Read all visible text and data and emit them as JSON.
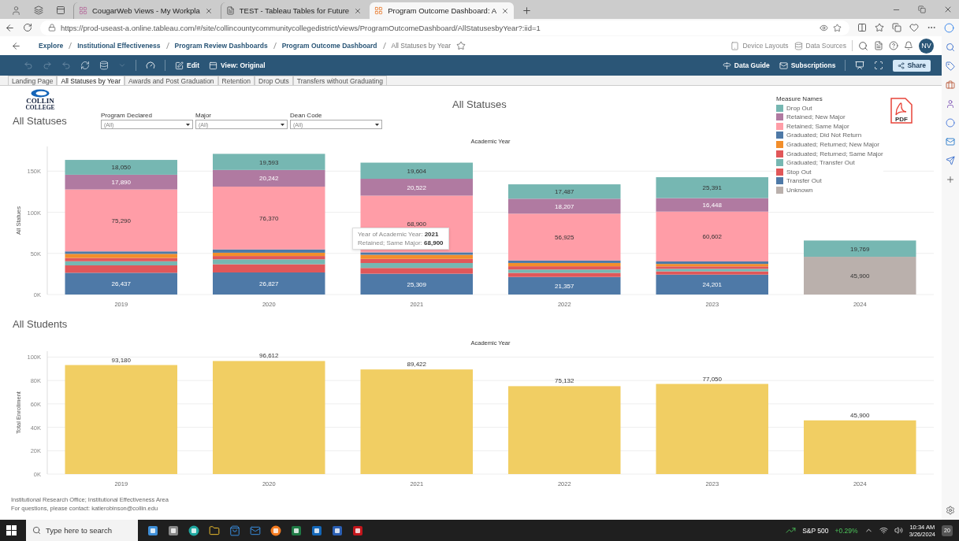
{
  "browser": {
    "tabs": [
      {
        "title": "CougarWeb Views - My Workpla",
        "selected": false
      },
      {
        "title": "TEST - Tableau Tables for Future",
        "selected": false
      },
      {
        "title": "Program Outcome Dashboard: A",
        "selected": true
      }
    ],
    "address": "https://prod-useast-a.online.tableau.com/#/site/collincountycommunitycollegedistrict/views/ProgramOutcomeDashboard/AllStatusesbyYear?:iid=1"
  },
  "breadcrumb": [
    {
      "label": "Explore",
      "current": false
    },
    {
      "label": "Institutional Effectiveness",
      "current": false
    },
    {
      "label": "Program Review Dashboards",
      "current": false
    },
    {
      "label": "Program Outcome Dashboard",
      "current": false
    },
    {
      "label": "All Statuses by Year",
      "current": true
    }
  ],
  "header_actions": [
    "Device Layouts",
    "Data Sources"
  ],
  "avatar": "NV",
  "toolbar": {
    "left": [
      "Edit",
      "View: Original"
    ],
    "right": [
      "Data Guide",
      "Subscriptions"
    ],
    "share": "Share"
  },
  "sheet_tabs": [
    {
      "label": "Landing Page",
      "selected": false
    },
    {
      "label": "All Statuses by Year",
      "selected": true
    },
    {
      "label": "Awards and Post Graduation",
      "selected": false
    },
    {
      "label": "Retention",
      "selected": false
    },
    {
      "label": "Drop Outs",
      "selected": false
    },
    {
      "label": "Transfers without Graduating",
      "selected": false
    }
  ],
  "dashboard": {
    "logo": [
      "COLLIN",
      "COLLEGE"
    ],
    "heading": "All Statuses",
    "title": "All Statuses",
    "filters": [
      {
        "label": "Program Declared",
        "value": "(All)"
      },
      {
        "label": "Major",
        "value": "(All)"
      },
      {
        "label": "Dean Code",
        "value": "(All)"
      }
    ],
    "pdf_label": "PDF",
    "legend": {
      "title": "Measure Names"
    },
    "statuses_chart": {
      "chart_data": {
        "type": "bar",
        "stacked": true,
        "grid": true,
        "xlabel": "Academic Year",
        "ylabel": "All Statues",
        "categories": [
          "2019",
          "2020",
          "2021",
          "2022",
          "2023",
          "2024"
        ],
        "series": [
          {
            "name": "Drop Out",
            "color": "#76b7b2",
            "values": [
              18050,
              19593,
              19604,
              17487,
              25391,
              19769
            ],
            "value_labels": [
              "18,050",
              "19,593",
              "19,604",
              "17,487",
              "25,391",
              "19,769"
            ]
          },
          {
            "name": "Retained; New Major",
            "color": "#b07aa1",
            "values": [
              17890,
              20242,
              20522,
              18207,
              16448,
              null
            ],
            "value_labels": [
              "17,890",
              "20,242",
              "20,522",
              "18,207",
              "16,448",
              null
            ]
          },
          {
            "name": "Retained; Same Major",
            "color": "#ff9da7",
            "values": [
              75290,
              76370,
              68900,
              56925,
              60602,
              null
            ],
            "value_labels": [
              "75,290",
              "76,370",
              "68,900",
              "56,925",
              "60,602",
              null
            ]
          },
          {
            "name": "Graduated; Did Not Return",
            "color": "#4e79a7",
            "values": [
              3000,
              4000,
              3000,
              3000,
              3000,
              null
            ]
          },
          {
            "name": "Graduated; Returned; New Major",
            "color": "#f28e2b",
            "values": [
              5000,
              4000,
              5000,
              4000,
              3000,
              null
            ]
          },
          {
            "name": "Graduated; Returned; Same Major",
            "color": "#e15759",
            "values": [
              4000,
              4000,
              5000,
              4000,
              3000,
              null
            ]
          },
          {
            "name": "Graduated; Transfer Out",
            "color": "#76b7b2",
            "values": [
              5000,
              6000,
              6000,
              4000,
              3000,
              null
            ]
          },
          {
            "name": "Stop Out",
            "color": "#e15759",
            "values": [
              9000,
              10000,
              7000,
              5000,
              4000,
              null
            ]
          },
          {
            "name": "Transfer Out",
            "color": "#4e79a7",
            "values": [
              26437,
              26827,
              25309,
              21357,
              24201,
              null
            ],
            "value_labels": [
              "26,437",
              "26,827",
              "25,309",
              "21,357",
              "24,201",
              null
            ]
          },
          {
            "name": "Unknown",
            "color": "#bab0ac",
            "values": [
              null,
              null,
              null,
              null,
              null,
              45900
            ],
            "value_labels": [
              null,
              null,
              null,
              null,
              null,
              "45,900"
            ]
          }
        ],
        "ylim": [
          0,
          180000
        ],
        "yticks": [
          {
            "value": 0,
            "label": "0K"
          },
          {
            "value": 50000,
            "label": "50K"
          },
          {
            "value": 100000,
            "label": "100K"
          },
          {
            "value": 150000,
            "label": "150K"
          }
        ]
      },
      "tooltip": {
        "lines": [
          {
            "label": "Year of Academic Year:",
            "value": "2021"
          },
          {
            "label": "Retained; Same Major:",
            "value": "68,900"
          }
        ]
      }
    },
    "students_heading": "All Students",
    "students_chart": {
      "chart_data": {
        "type": "bar",
        "grid": true,
        "xlabel": "Academic Year",
        "ylabel": "Total Enrollment",
        "categories": [
          "2019",
          "2020",
          "2021",
          "2022",
          "2023",
          "2024"
        ],
        "values": [
          93180,
          96612,
          89422,
          75132,
          77050,
          45900
        ],
        "value_labels": [
          "93,180",
          "96,612",
          "89,422",
          "75,132",
          "77,050",
          "45,900"
        ],
        "ylim": [
          0,
          105000
        ],
        "yticks": [
          {
            "value": 0,
            "label": "0K"
          },
          {
            "value": 20000,
            "label": "20K"
          },
          {
            "value": 40000,
            "label": "40K"
          },
          {
            "value": 60000,
            "label": "60K"
          },
          {
            "value": 80000,
            "label": "80K"
          },
          {
            "value": 100000,
            "label": "100K"
          }
        ]
      }
    },
    "footer": [
      "Institutional Research Office; Institutional Effectiveness Area",
      "For questions, please contact: katierobinson@collin.edu"
    ]
  },
  "taskbar": {
    "search_placeholder": "Type here to search",
    "ticker": "S&P 500",
    "change": "+0.29%",
    "time": "10:34 AM",
    "date": "3/26/2024",
    "notifications": "20"
  }
}
